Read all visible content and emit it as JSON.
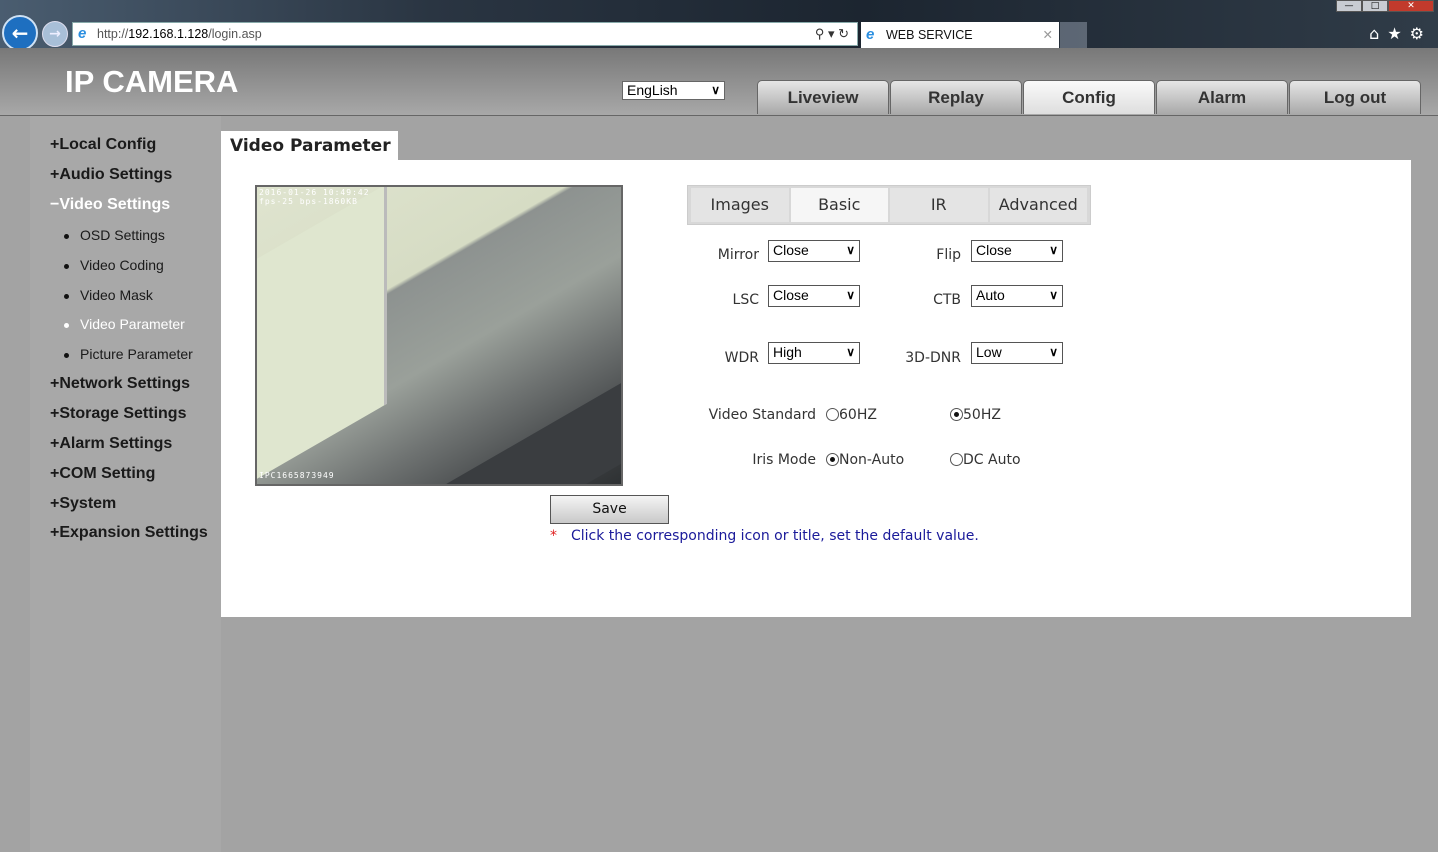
{
  "browser": {
    "url_prefix": "http://",
    "url_host": "192.168.1.128",
    "url_path": "/login.asp",
    "tab_title": "WEB SERVICE"
  },
  "header": {
    "logo": "IP CAMERA",
    "language": "EngLish",
    "nav": [
      "Liveview",
      "Replay",
      "Config",
      "Alarm",
      "Log out"
    ],
    "active_nav": "Config"
  },
  "sidebar": {
    "items": [
      {
        "sign": "+",
        "label": "Local Config"
      },
      {
        "sign": "+",
        "label": "Audio Settings"
      },
      {
        "sign": "−",
        "label": "Video Settings"
      },
      {
        "sign": "+",
        "label": "Network Settings"
      },
      {
        "sign": "+",
        "label": "Storage Settings"
      },
      {
        "sign": "+",
        "label": "Alarm Settings"
      },
      {
        "sign": "+",
        "label": "COM Setting"
      },
      {
        "sign": "+",
        "label": "System"
      },
      {
        "sign": "+",
        "label": "Expansion Settings"
      }
    ],
    "sub_items": [
      "OSD Settings",
      "Video Coding",
      "Video Mask",
      "Video Parameter",
      "Picture Parameter"
    ],
    "active_sub": "Video Parameter"
  },
  "page": {
    "title": "Video Parameter"
  },
  "video": {
    "osd_time": "2016-01-26 10:49:42",
    "osd_rate": "fps-25 bps-1860KB",
    "osd_name": "IPC1665873949"
  },
  "subtabs": [
    "Images",
    "Basic",
    "IR",
    "Advanced"
  ],
  "active_subtab": "Basic",
  "form": {
    "mirror": {
      "label": "Mirror",
      "value": "Close"
    },
    "flip": {
      "label": "Flip",
      "value": "Close"
    },
    "lsc": {
      "label": "LSC",
      "value": "Close"
    },
    "ctb": {
      "label": "CTB",
      "value": "Auto"
    },
    "wdr": {
      "label": "WDR",
      "value": "High"
    },
    "dnr": {
      "label": "3D-DNR",
      "value": "Low"
    },
    "video_standard": {
      "label": "Video Standard",
      "options": [
        "60HZ",
        "50HZ"
      ],
      "selected": "50HZ"
    },
    "iris_mode": {
      "label": "Iris Mode",
      "options": [
        "Non-Auto",
        "DC Auto"
      ],
      "selected": "Non-Auto"
    }
  },
  "save_label": "Save",
  "note": {
    "star": "*",
    "text": "Click the corresponding icon or title, set the default value."
  }
}
